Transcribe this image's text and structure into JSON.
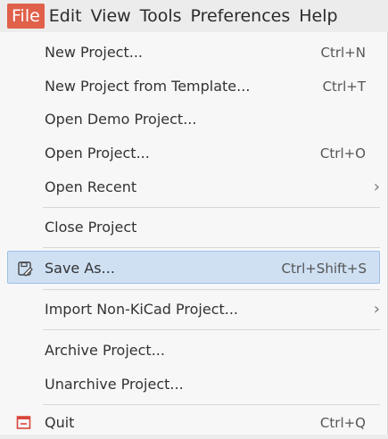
{
  "menubar": {
    "items": [
      "File",
      "Edit",
      "View",
      "Tools",
      "Preferences",
      "Help"
    ]
  },
  "file_menu": {
    "new_project": {
      "label": "New Project...",
      "shortcut": "Ctrl+N"
    },
    "new_from_template": {
      "label": "New Project from Template...",
      "shortcut": "Ctrl+T"
    },
    "open_demo": {
      "label": "Open Demo Project..."
    },
    "open_project": {
      "label": "Open Project...",
      "shortcut": "Ctrl+O"
    },
    "open_recent": {
      "label": "Open Recent",
      "arrow": "›"
    },
    "close_project": {
      "label": "Close Project"
    },
    "save_as": {
      "label": "Save As...",
      "shortcut": "Ctrl+Shift+S"
    },
    "import_non_kicad": {
      "label": "Import Non-KiCad Project...",
      "arrow": "›"
    },
    "archive": {
      "label": "Archive Project..."
    },
    "unarchive": {
      "label": "Unarchive Project..."
    },
    "quit": {
      "label": "Quit",
      "shortcut": "Ctrl+Q"
    }
  },
  "colors": {
    "active_menu": "#e0604a",
    "highlight_bg": "#cfe0f3",
    "highlight_border": "#9dc0e8",
    "quit_icon": "#d9463a"
  }
}
